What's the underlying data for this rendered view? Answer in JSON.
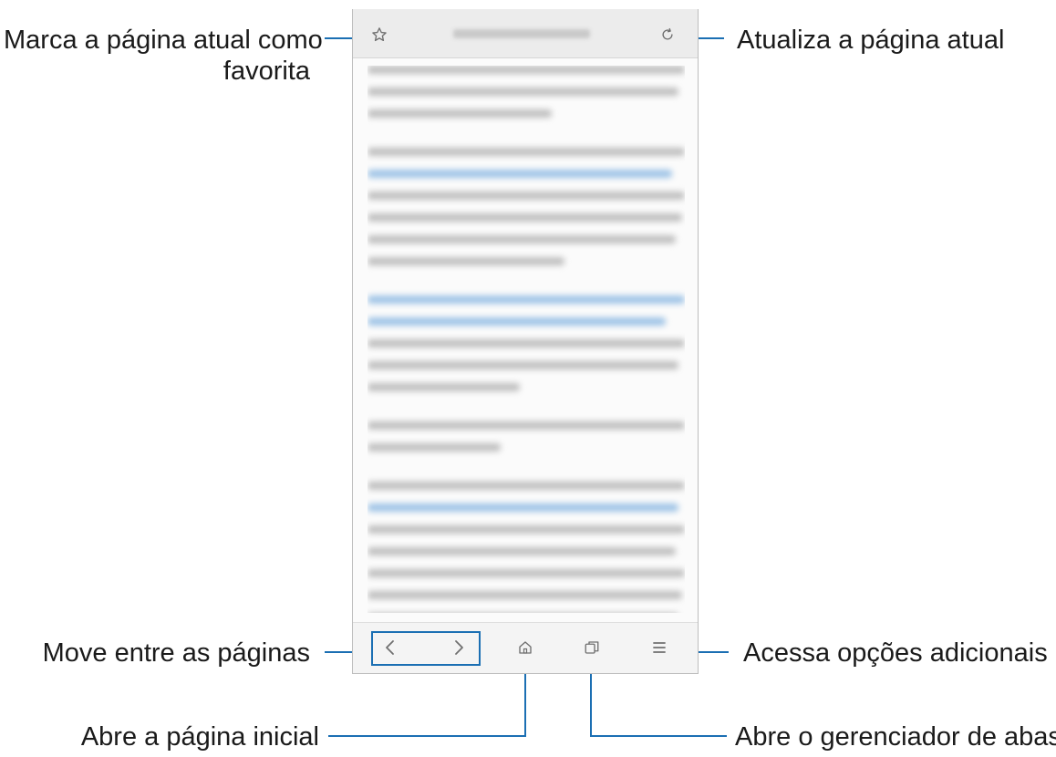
{
  "callouts": {
    "bookmark": [
      "Marca a página atual como",
      "favorita"
    ],
    "refresh": "Atualiza a página atual",
    "navigate": "Move entre as páginas",
    "more": "Acessa opções adicionais",
    "home": "Abre a página inicial",
    "tabs": "Abre o gerenciador de abas"
  },
  "icons": {
    "bookmark": "star-outline-icon",
    "refresh": "refresh-icon",
    "back": "chevron-left-icon",
    "forward": "chevron-right-icon",
    "home": "home-icon",
    "tabs": "tabs-icon",
    "menu": "menu-icon"
  },
  "colors": {
    "callout_line": "#1b6fb3",
    "toolbar_icons": "#6f6f6f"
  }
}
